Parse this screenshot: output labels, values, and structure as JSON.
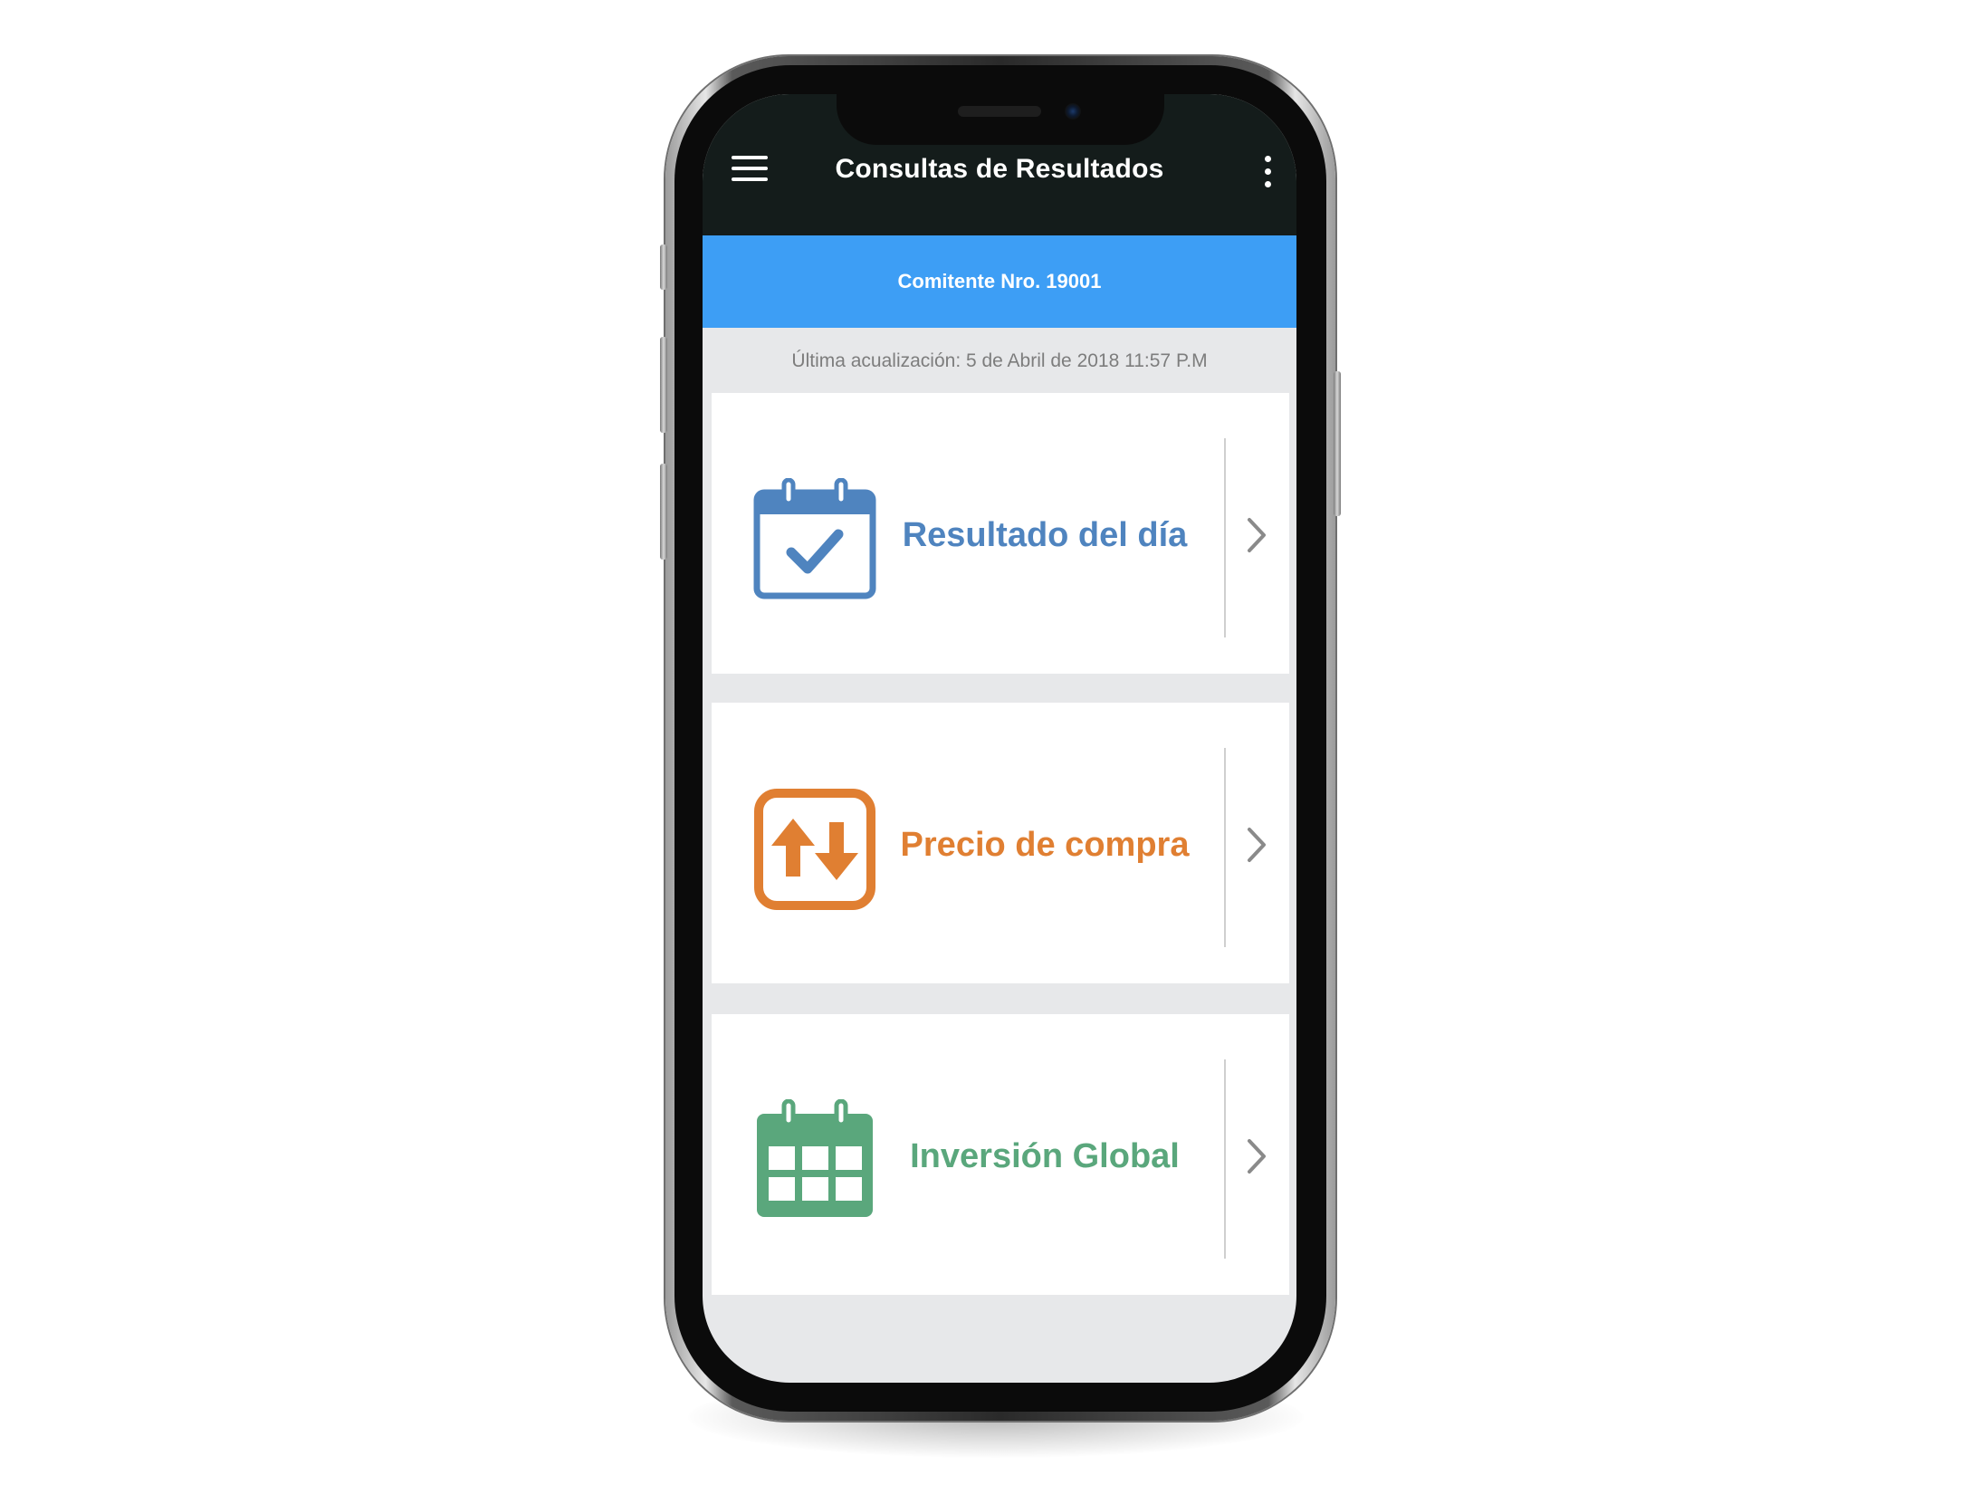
{
  "app_bar": {
    "title": "Consultas de Resultados",
    "menu_icon": "hamburger-menu-icon",
    "more_icon": "more-vertical-icon"
  },
  "account": {
    "label": "Comitente Nro. 19001"
  },
  "last_update": {
    "text": "Última acualización: 5 de Abril de 2018 11:57 P.M"
  },
  "cards": [
    {
      "label": "Resultado del día",
      "icon": "calendar-check-icon",
      "color": "#4f84bf"
    },
    {
      "label": "Precio de compra",
      "icon": "up-down-arrows-icon",
      "color": "#e07f32"
    },
    {
      "label": "Inversión Global",
      "icon": "calendar-grid-icon",
      "color": "#5aa77c"
    }
  ],
  "colors": {
    "app_bar": "#141c1b",
    "account_bar": "#3d9ef5",
    "background": "#e7e8ea",
    "chevron": "#8a8a8a"
  }
}
